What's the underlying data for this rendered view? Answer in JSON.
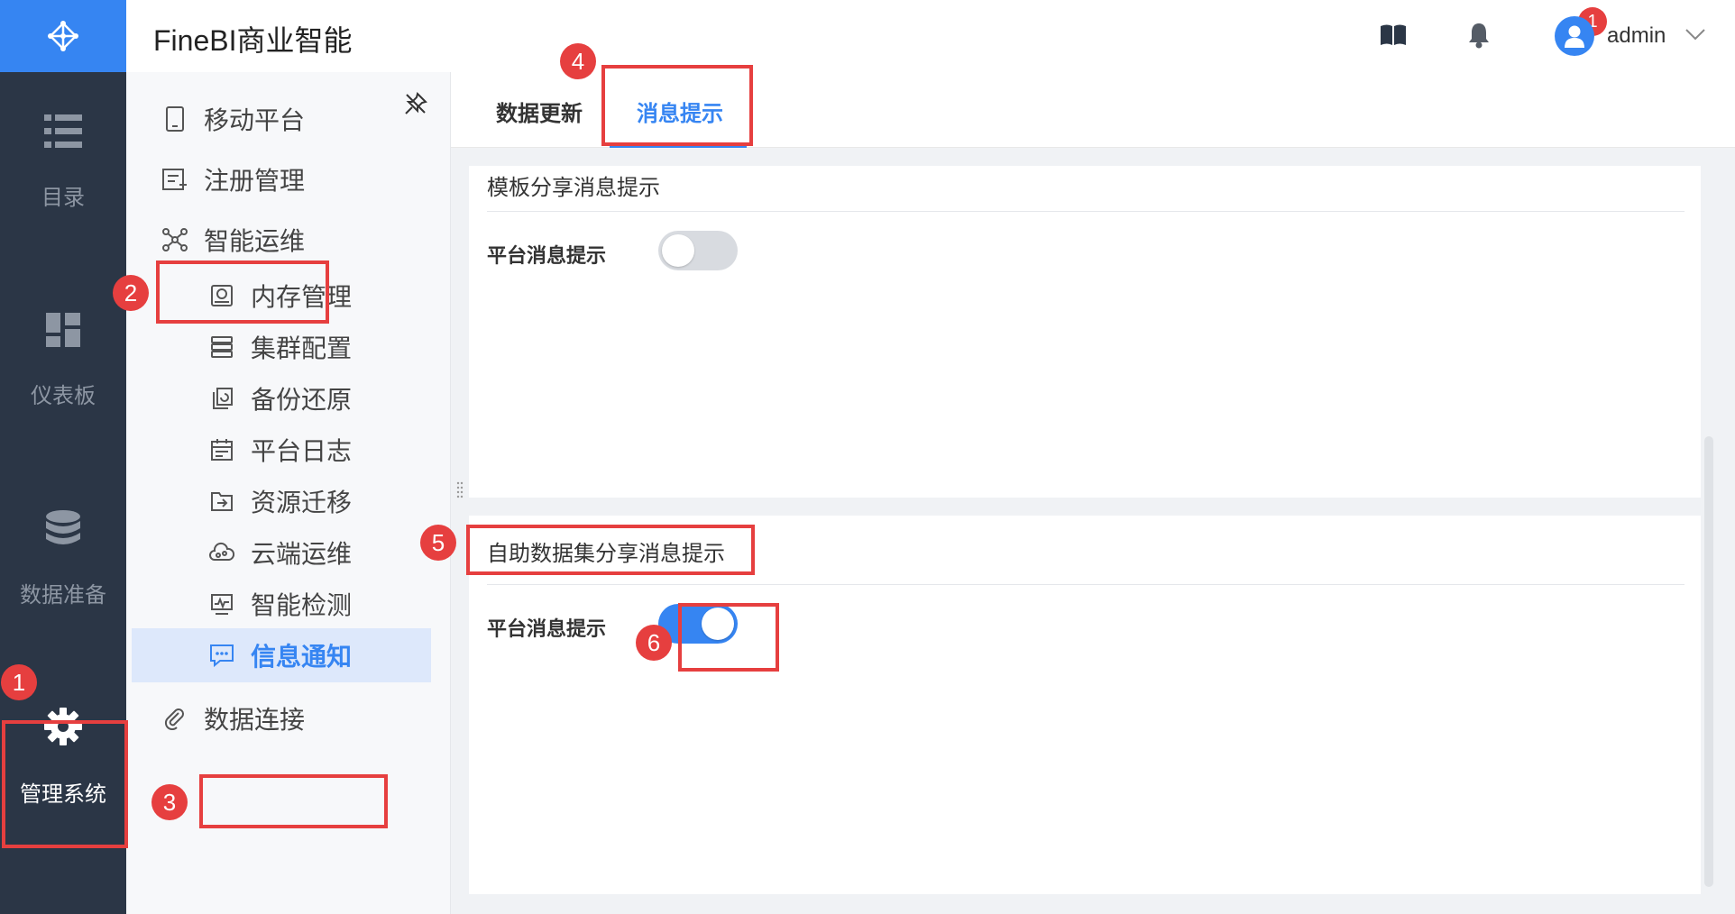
{
  "header": {
    "app_title": "FineBI商业智能",
    "notification_count": "1",
    "username": "admin"
  },
  "rail": {
    "items": [
      {
        "label": "目录",
        "icon": "list-icon"
      },
      {
        "label": "仪表板",
        "icon": "dashboard-icon"
      },
      {
        "label": "数据准备",
        "icon": "database-icon"
      },
      {
        "label": "管理系统",
        "icon": "gear-icon",
        "active": true
      }
    ]
  },
  "menu": {
    "items": [
      {
        "label": "移动平台",
        "icon": "tablet-icon"
      },
      {
        "label": "注册管理",
        "icon": "register-icon"
      },
      {
        "label": "智能运维",
        "icon": "ops-network-icon"
      },
      {
        "label": "内存管理",
        "icon": "memory-icon"
      },
      {
        "label": "集群配置",
        "icon": "cluster-icon"
      },
      {
        "label": "备份还原",
        "icon": "backup-icon"
      },
      {
        "label": "平台日志",
        "icon": "log-icon"
      },
      {
        "label": "资源迁移",
        "icon": "migrate-icon"
      },
      {
        "label": "云端运维",
        "icon": "cloud-ops-icon"
      },
      {
        "label": "智能检测",
        "icon": "monitor-icon"
      },
      {
        "label": "信息通知",
        "icon": "message-icon",
        "active": true
      },
      {
        "label": "数据连接",
        "icon": "link-icon"
      }
    ]
  },
  "tabs": [
    {
      "label": "数据更新"
    },
    {
      "label": "消息提示",
      "active": true
    }
  ],
  "sections": [
    {
      "title": "模板分享消息提示",
      "row_label": "平台消息提示",
      "toggle_on": false
    },
    {
      "title": "自助数据集分享消息提示",
      "row_label": "平台消息提示",
      "toggle_on": true
    }
  ],
  "steps": [
    "1",
    "2",
    "3",
    "4",
    "5",
    "6"
  ],
  "colors": {
    "accent": "#3685f2",
    "rail_bg": "#2b3646",
    "annotation_red": "#e63f3f"
  }
}
